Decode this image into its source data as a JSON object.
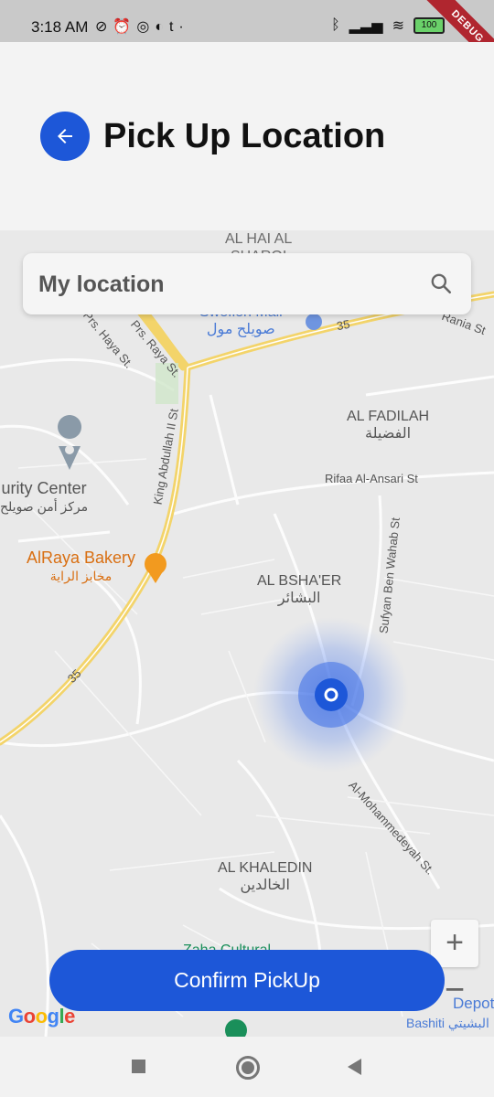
{
  "status_bar": {
    "time": "3:18 AM",
    "left_icons": [
      "wifi-off-icon",
      "alarm-icon",
      "whatsapp-icon",
      "app-icon",
      "tumblr-icon",
      "dot-icon"
    ],
    "right_icons": [
      "bluetooth-icon",
      "signal-icon",
      "wifi-icon",
      "battery-icon"
    ],
    "battery_level": "100",
    "debug_banner": "DEBUG"
  },
  "header": {
    "back_icon": "arrow-left-icon",
    "title": "Pick Up Location"
  },
  "search": {
    "value": "My location",
    "icon": "search-icon"
  },
  "map": {
    "labels": {
      "al_hai": "AL HAI AL",
      "al_hai_2": "SHARQI",
      "swefieh_mall": "Swefieh Mall",
      "swefieh_mall_ar": "صويلح مول",
      "al_fadilah": "AL FADILAH",
      "al_fadilah_ar": "الفضيلة",
      "security_center": "urity Center",
      "security_center_ar": "مركز أمن صويلح",
      "alraya_bakery": "AlRaya Bakery",
      "alraya_bakery_ar": "مخابز الراية",
      "al_bshaer": "AL BSHA'ER",
      "al_bshaer_ar": "البشائر",
      "al_khaledin": "AL KHALEDIN",
      "al_khaledin_ar": "الخالدين",
      "zaha_cultural": "Zaha Cultural",
      "bashiti_depot": "Depot",
      "bashiti": "Bashiti",
      "bashiti_ar": "البشيتي"
    },
    "streets": {
      "prs_haya": "Prs. Haya St.",
      "prs_raya": "Prs. Raya St.",
      "king_abdullah": "King Abdullah II St",
      "rifaa": "Rifaa Al-Ansari St",
      "sufyan": "Sufyan Ben Wahab St",
      "al_mohammedeyah": "Al-Mohammedeyah St.",
      "route_35": "35",
      "route_35_b": "35",
      "rania": "Rania St"
    },
    "zoom_in": "+",
    "zoom_out": "−",
    "attribution": "Google"
  },
  "confirm_button": "Confirm PickUp",
  "nav_bar": {
    "recent": "square-icon",
    "home": "circle-icon",
    "back": "triangle-back-icon"
  },
  "colors": {
    "accent": "#1d57d8",
    "road_major": "#f5d76e",
    "map_bg": "#e8e8e8"
  }
}
